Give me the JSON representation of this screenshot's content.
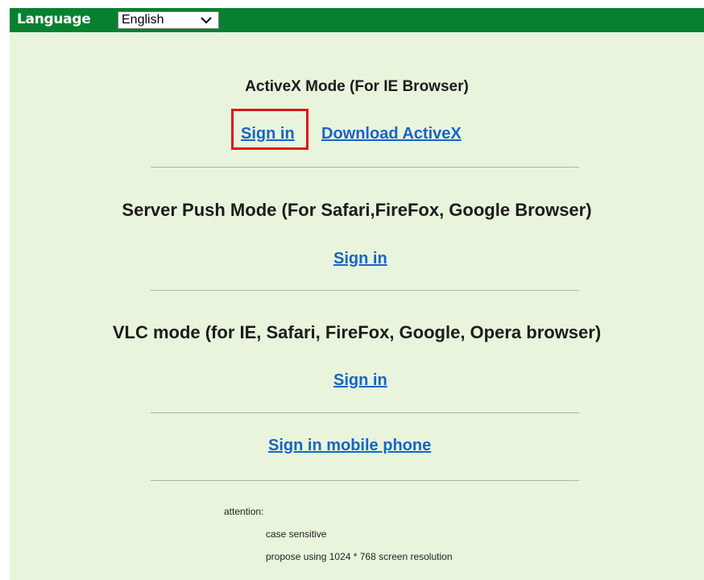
{
  "header": {
    "language_label": "Language",
    "language_value": "English",
    "language_dropdown_icon": "chevron-down-icon"
  },
  "sections": {
    "activex": {
      "heading": "ActiveX Mode (For IE Browser)",
      "sign_in": "Sign in",
      "download": "Download ActiveX"
    },
    "server_push": {
      "heading": "Server Push Mode (For Safari,FireFox, Google Browser)",
      "sign_in": "Sign in"
    },
    "vlc": {
      "heading": "VLC mode (for IE, Safari, FireFox, Google, Opera browser)",
      "sign_in": "Sign in"
    },
    "mobile": {
      "sign_in": "Sign in mobile phone"
    }
  },
  "attention": {
    "title": "attention:",
    "items": [
      "case sensitive",
      "propose using 1024 * 768 screen resolution"
    ]
  },
  "colors": {
    "header_bg": "#078030",
    "page_bg": "#e8f5dc",
    "link": "#1665c6",
    "highlight_border": "#e0141f"
  }
}
